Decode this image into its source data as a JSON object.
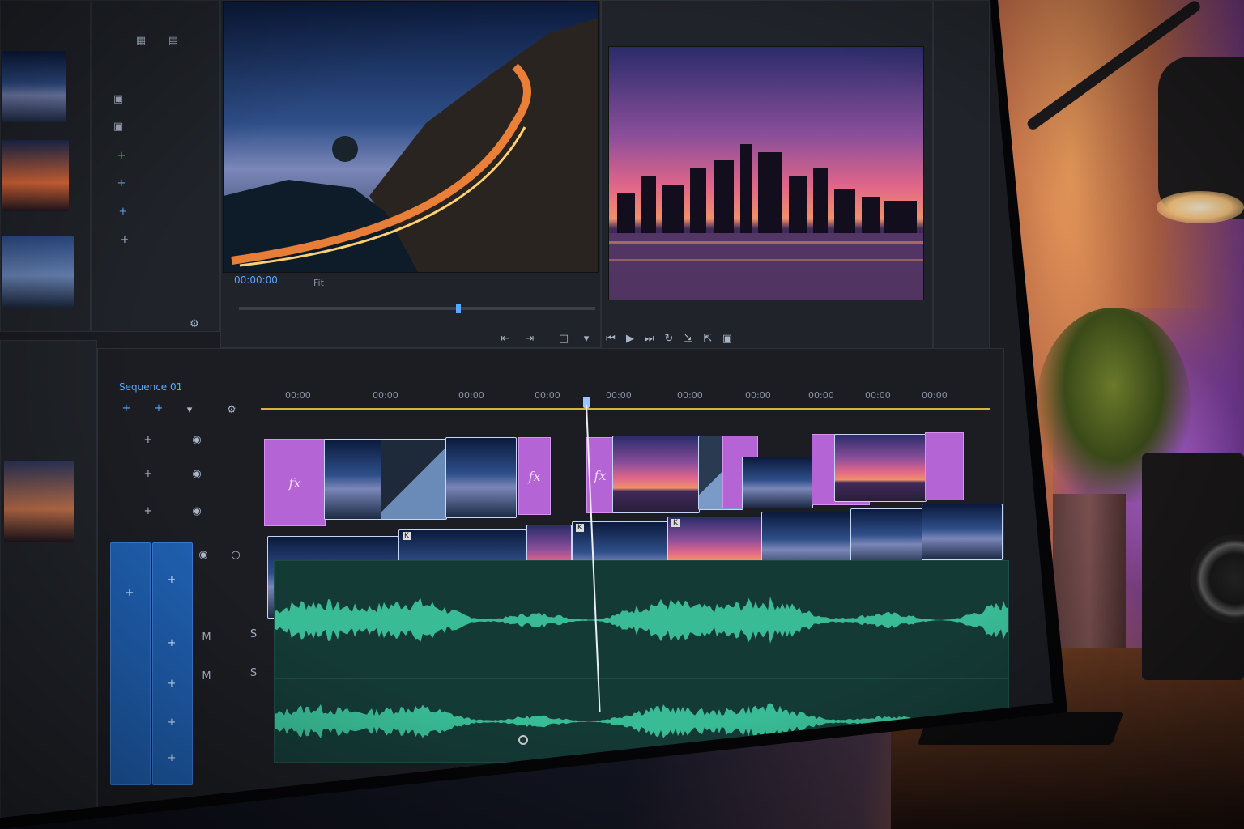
{
  "app": {
    "name": "video editor"
  },
  "program_monitor": {
    "timecode": "00:00:00",
    "zoom_label": "Fit"
  },
  "timeline": {
    "sequence_name": "Sequence 01",
    "ruler_ticks": [
      "00:00",
      "00:00",
      "00:00",
      "00:00",
      "00:00",
      "00:00",
      "00:00",
      "00:00",
      "00:00",
      "00:00"
    ],
    "fx_label": "fx",
    "keyframe_label": "K"
  },
  "colors": {
    "accent": "#57a8ff",
    "fx_clip": "#b564d6",
    "audio_wave": "#3fd3a6",
    "track_header": "#1f5fb0",
    "playhead": "#e8eef8",
    "work_area": "#d6b43a"
  },
  "icons": {
    "add": "+",
    "eye": "◉",
    "lock": "🔒",
    "mute": "M",
    "solo": "S",
    "marker": "▾",
    "play": "▶",
    "step_back": "⏮",
    "step_forward": "⏭",
    "settings": "⚙"
  }
}
